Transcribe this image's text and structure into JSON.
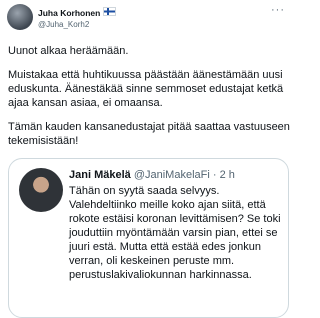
{
  "tweet": {
    "author_name": "Juha Korhonen",
    "author_handle": "@Juha_Korh2",
    "more_icon": "more-horizontal-icon",
    "paragraphs": [
      "Uunot alkaa heräämään.",
      "Muistakaa että huhtikuussa päästään äänestämään uusi eduskunta. Äänestäkää sinne semmoset edustajat ketkä ajaa kansan asiaa, ei omaansa.",
      "Tämän kauden kansanedustajat pitää saattaa vastuuseen tekemisistään!"
    ]
  },
  "quoted": {
    "author_name": "Jani Mäkelä",
    "author_handle": "@JaniMakelaFi",
    "separator": "·",
    "time": "2 h",
    "text": "Tähän on syytä saada selvyys. Valehdeltiinko meille koko ajan siitä, että rokote estäisi koronan levittämisen? Se toki jouduttiin myöntämään varsin pian, ettei se juuri estä. Mutta että estää edes jonkun verran, oli keskeinen peruste mm. perustuslakivaliokunnan harkinnassa."
  }
}
